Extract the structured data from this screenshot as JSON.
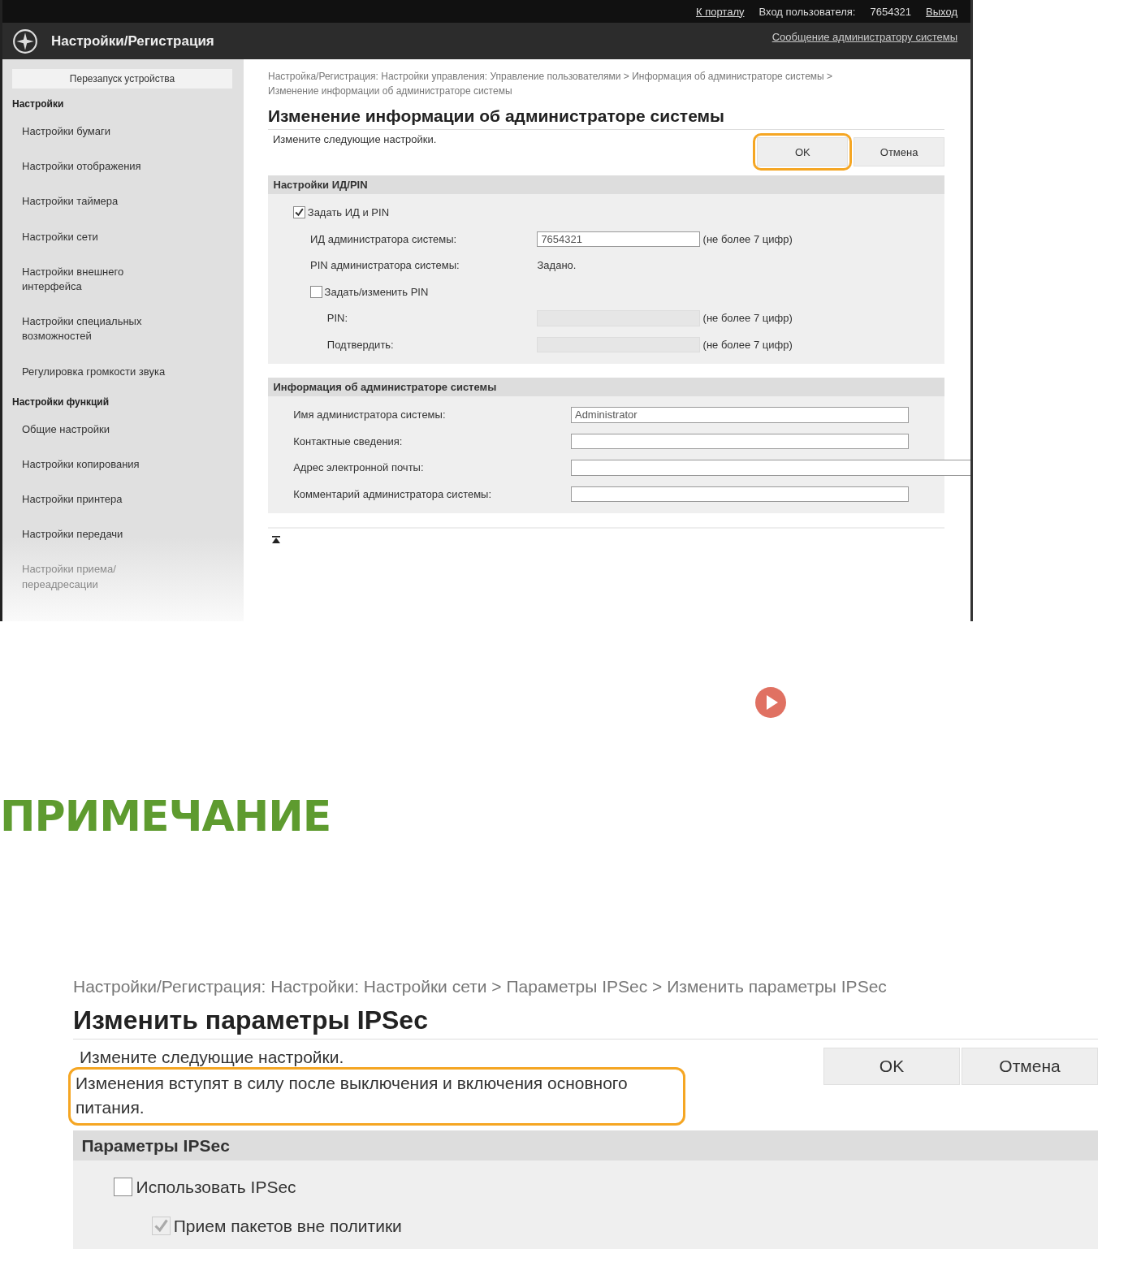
{
  "top_screen": {
    "top_bar": {
      "portal_link": "К порталу",
      "login_label": "Вход пользователя:",
      "user": "7654321",
      "logout_link": "Выход"
    },
    "header": {
      "title": "Настройки/Регистрация",
      "message_link": "Сообщение администратору системы"
    },
    "sidebar": {
      "restart_button": "Перезапуск устройства",
      "groups": [
        {
          "title": "Настройки",
          "items": [
            {
              "label": "Настройки бумаги",
              "faded": false
            },
            {
              "label": "Настройки отображения",
              "faded": false
            },
            {
              "label": "Настройки таймера",
              "faded": false
            },
            {
              "label": "Настройки сети",
              "faded": false
            },
            {
              "label": "Настройки внешнего интерфейса",
              "faded": false
            },
            {
              "label": "Настройки специальных возможностей",
              "faded": false
            },
            {
              "label": "Регулировка громкости звука",
              "faded": false
            }
          ]
        },
        {
          "title": "Настройки функций",
          "items": [
            {
              "label": "Общие настройки",
              "faded": false
            },
            {
              "label": "Настройки копирования",
              "faded": false
            },
            {
              "label": "Настройки принтера",
              "faded": false
            },
            {
              "label": "Настройки передачи",
              "faded": false
            },
            {
              "label": "Настройки приема/переадресации",
              "faded": true
            }
          ]
        }
      ]
    },
    "breadcrumb": "Настройка/Регистрация: Настройки управления: Управление пользователями > Информация об администраторе системы > Изменение информации об администраторе системы",
    "title": "Изменение информации об администраторе системы",
    "instruction": "Измените следующие настройки.",
    "buttons": [
      {
        "label": "OK",
        "highlighted": true
      },
      {
        "label": "Отмена",
        "highlighted": false
      }
    ],
    "sections": [
      {
        "title": "Настройки ИД/PIN",
        "rows": [
          {
            "kind": "checkbox",
            "label": "Задать ИД и PIN",
            "checked": true,
            "disabled": false,
            "children": [
              {
                "kind": "field",
                "label": "ИД администратора системы:",
                "value": "7654321",
                "disabled": false,
                "hint": "(не более 7 цифр)"
              },
              {
                "kind": "value",
                "label": "PIN администратора системы:",
                "value": "Задано."
              },
              {
                "kind": "checkbox",
                "label": "Задать/изменить PIN",
                "checked": false,
                "disabled": false,
                "children": [
                  {
                    "kind": "field",
                    "label": "PIN:",
                    "disabled": true,
                    "hint": "(не более 7 цифр)"
                  },
                  {
                    "kind": "field",
                    "label": "Подтвердить:",
                    "disabled": true,
                    "hint": "(не более 7 цифр)"
                  }
                ]
              }
            ]
          }
        ]
      },
      {
        "title": "Информация об администраторе системы",
        "rows": [
          {
            "kind": "field",
            "label": "Имя администратора системы:",
            "value": "Administrator",
            "disabled": false,
            "wide": false
          },
          {
            "kind": "field",
            "label": "Контактные сведения:",
            "disabled": false,
            "wide": false
          },
          {
            "kind": "field",
            "label": "Адрес электронной почты:",
            "disabled": false,
            "wide": true
          },
          {
            "kind": "field",
            "label": "Комментарий администратора системы:",
            "disabled": false,
            "wide": false
          }
        ]
      }
    ]
  },
  "note_heading": "ПРИМЕЧАНИЕ",
  "bottom_screen": {
    "breadcrumb": "Настройки/Регистрация: Настройки: Настройки сети > Параметры IPSec > Изменить параметры IPSec",
    "title": "Изменить параметры IPSec",
    "instruction": "Измените следующие настройки.",
    "notice": {
      "text": "Изменения вступят в силу после выключения и включения основного питания.",
      "highlighted": true
    },
    "buttons": [
      {
        "label": "OK",
        "highlighted": false
      },
      {
        "label": "Отмена",
        "highlighted": false
      }
    ],
    "sections": [
      {
        "title": "Параметры IPSec",
        "rows": [
          {
            "kind": "checkbox",
            "label": "Использовать IPSec",
            "checked": false,
            "disabled": false,
            "children": [
              {
                "kind": "checkbox",
                "label": "Прием пакетов вне политики",
                "checked": true,
                "disabled": true
              }
            ]
          }
        ]
      }
    ]
  }
}
